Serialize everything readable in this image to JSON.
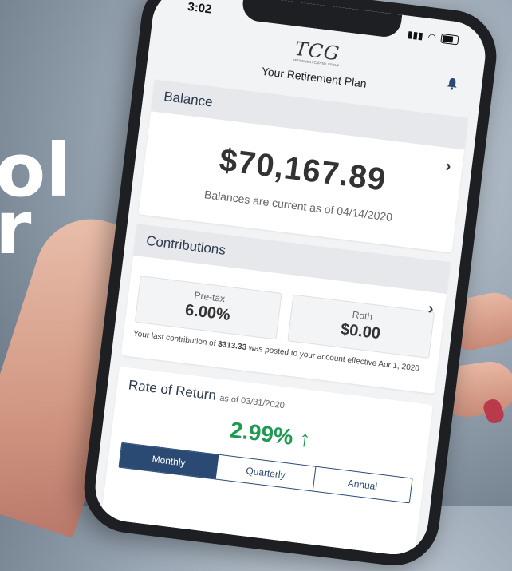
{
  "background": {
    "line1": "ol",
    "line2": "r"
  },
  "status_bar": {
    "time": "3:02"
  },
  "header": {
    "logo": "TCG",
    "logo_sub": "RETIREMENT CAPITAL GROUP",
    "title": "Your Retirement Plan"
  },
  "balance": {
    "title": "Balance",
    "amount": "$70,167.89",
    "note": "Balances are current as of 04/14/2020"
  },
  "contributions": {
    "title": "Contributions",
    "pretax_label": "Pre-tax",
    "pretax_value": "6.00%",
    "roth_label": "Roth",
    "roth_value": "$0.00",
    "note_prefix": "Your last contribution of ",
    "note_amount": "$313.33",
    "note_suffix": " was posted to your account effective Apr 1, 2020"
  },
  "rate_of_return": {
    "title": "Rate of Return",
    "as_of": "as of 03/31/2020",
    "value": "2.99%",
    "arrow": "↑",
    "tabs": [
      "Monthly",
      "Quarterly",
      "Annual"
    ],
    "active_tab": "Monthly"
  },
  "colors": {
    "accent": "#2a4a73",
    "positive": "#1e9a52"
  }
}
